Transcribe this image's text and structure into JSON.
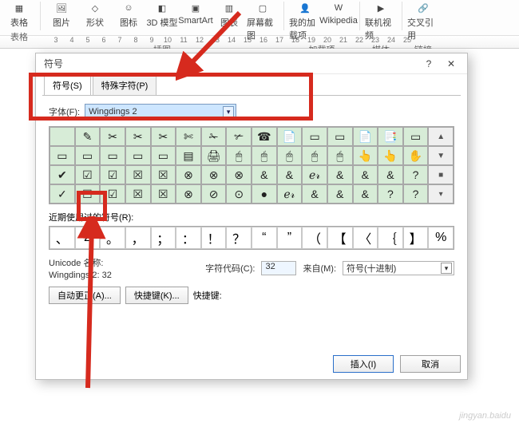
{
  "ribbon": {
    "groups": [
      {
        "label": "表格",
        "items": [
          {
            "t": "表格",
            "icon": "▦"
          }
        ]
      },
      {
        "label": "插图",
        "items": [
          {
            "t": "图片",
            "icon": "🖼"
          },
          {
            "t": "形状",
            "icon": "◇"
          },
          {
            "t": "图标",
            "icon": "☺"
          },
          {
            "t": "3D 模型",
            "icon": "◧"
          },
          {
            "t": "SmartArt",
            "icon": "▣"
          },
          {
            "t": "图表",
            "icon": "▥"
          },
          {
            "t": "屏幕截图",
            "icon": "▢"
          }
        ]
      },
      {
        "label": "加载项",
        "items": [
          {
            "t": "我的加载项",
            "icon": "👤"
          },
          {
            "t": "Wikipedia",
            "icon": "W"
          }
        ]
      },
      {
        "label": "媒体",
        "items": [
          {
            "t": "联机视频",
            "icon": "▶"
          }
        ]
      },
      {
        "label": "链接",
        "items": [
          {
            "t": "交叉引用",
            "icon": "🔗"
          }
        ]
      }
    ]
  },
  "ruler": [
    "3",
    "4",
    "5",
    "6",
    "7",
    "8",
    "9",
    "10",
    "11",
    "12",
    "13",
    "14",
    "15",
    "16",
    "17",
    "18",
    "19",
    "20",
    "21",
    "22",
    "23",
    "24",
    "25"
  ],
  "dialog": {
    "title": "符号",
    "tabs": [
      "符号(S)",
      "特殊字符(P)"
    ],
    "active_tab": 0,
    "font_label": "字体(F):",
    "font_value": "Wingdings 2",
    "grid": [
      [
        " ",
        "✎",
        "✂",
        "✂",
        "✂",
        "✄",
        "✁",
        "✃",
        "☎",
        "📄",
        "▭",
        "▭",
        "📄",
        "📑",
        "▭",
        "▲"
      ],
      [
        "▭",
        "▭",
        "▭",
        "▭",
        "▭",
        "▤",
        "🖨",
        "🖱",
        "🖱",
        "🖱",
        "🖱",
        "🖱",
        "👆",
        "👆",
        "✋",
        "▼"
      ],
      [
        "✔",
        "☑",
        "☑",
        "☒",
        "☒",
        "⊗",
        "⊗",
        "⊗",
        "&",
        "&",
        "ℯ𝓇",
        "&",
        "&",
        "&",
        "?",
        "■"
      ],
      [
        "✓",
        "☐",
        "☑",
        "☒",
        "☒",
        "⊗",
        "⊘",
        "⊙",
        "●",
        "ℯ𝓇",
        "&",
        "&",
        "&",
        "?",
        "?",
        "▾"
      ]
    ],
    "recent_label": "近期使用过的符号(R):",
    "recent": [
      "、",
      "2",
      "。",
      "，",
      "；",
      "：",
      "！",
      "？",
      "“",
      "”",
      "（",
      "【",
      "〈",
      "｛",
      "】",
      "%"
    ],
    "unicode_name_label": "Unicode 名称:",
    "unicode_name_value": "Wingdings 2: 32",
    "code_label": "字符代码(C):",
    "code_value": "32",
    "from_label": "来自(M):",
    "from_value": "符号(十进制)",
    "autocorrect_btn": "自动更正(A)...",
    "shortcut_btn": "快捷键(K)...",
    "shortcut_label": "快捷键:",
    "insert_btn": "插入(I)",
    "cancel_btn": "取消"
  },
  "watermark": "jingyan.baidu"
}
